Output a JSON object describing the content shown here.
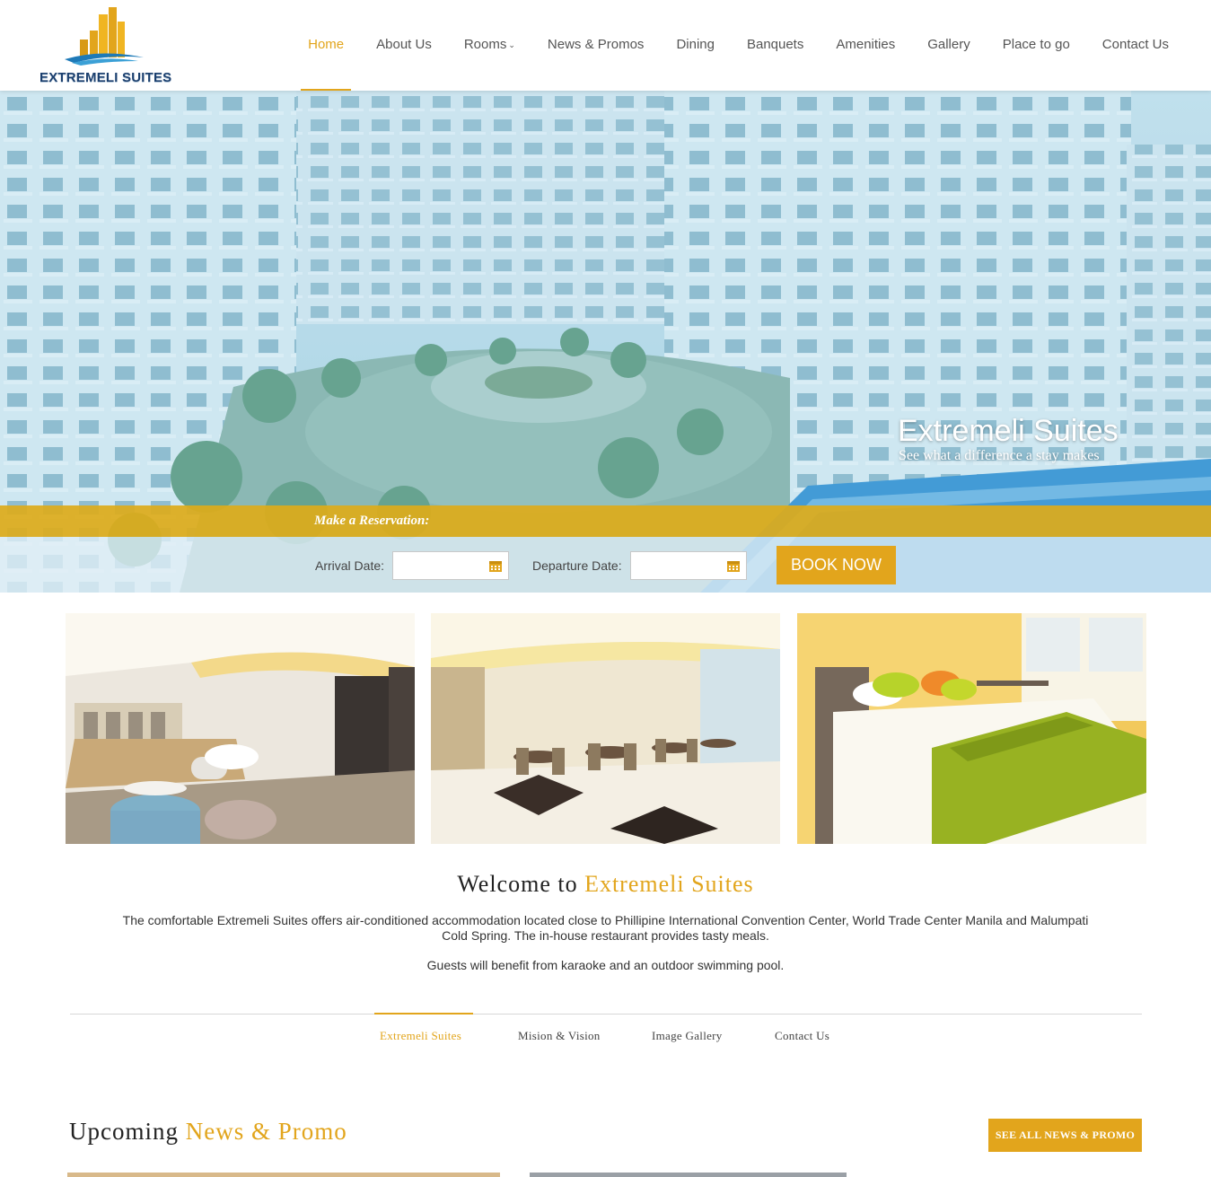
{
  "header": {
    "logo_text": "EXTREMELI SUITES",
    "nav": [
      {
        "label": "Home",
        "active": true
      },
      {
        "label": "About Us"
      },
      {
        "label": "Rooms",
        "dropdown": true
      },
      {
        "label": "News & Promos"
      },
      {
        "label": "Dining"
      },
      {
        "label": "Banquets"
      },
      {
        "label": "Amenities"
      },
      {
        "label": "Gallery"
      },
      {
        "label": "Place to go"
      },
      {
        "label": "Contact Us"
      }
    ]
  },
  "hero": {
    "title": "Extremeli Suites",
    "subtitle": "See what a difference a stay makes"
  },
  "reservation": {
    "title": "Make a Reservation:",
    "arrival_label": "Arrival Date:",
    "arrival_value": "",
    "departure_label": "Departure Date:",
    "departure_value": "",
    "book_label": "BOOK NOW"
  },
  "welcome": {
    "prefix": "Welcome to ",
    "highlight": "Extremeli Suites",
    "paragraph1": "The comfortable Extremeli Suites offers air-conditioned accommodation located close to Phillipine International Convention Center, World Trade Center Manila and Malumpati Cold Spring. The in-house restaurant provides tasty meals.",
    "paragraph2": "Guests will benefit from karaoke and an outdoor swimming pool."
  },
  "tabs": [
    {
      "label": "Extremeli Suites",
      "active": true
    },
    {
      "label": "Mision & Vision"
    },
    {
      "label": "Image Gallery"
    },
    {
      "label": "Contact Us"
    }
  ],
  "news": {
    "prefix": "Upcoming ",
    "highlight": "News & Promo",
    "see_all_label": "SEE ALL NEWS & PROMO"
  },
  "colors": {
    "accent": "#e2a51c",
    "nav_text": "#555555",
    "brand_blue": "#1b3f6e"
  }
}
